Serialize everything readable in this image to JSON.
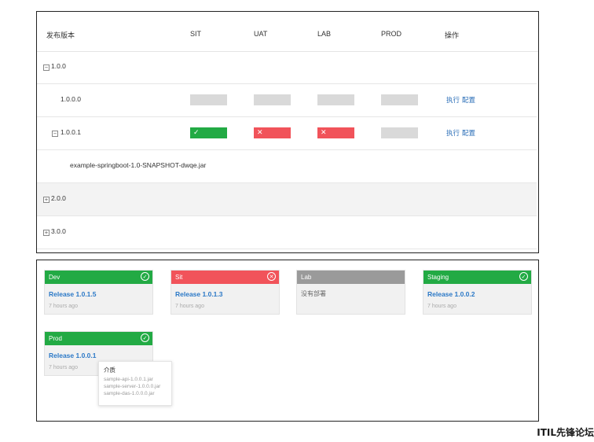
{
  "table": {
    "headers": {
      "version": "发布版本",
      "sit": "SIT",
      "uat": "UAT",
      "lab": "LAB",
      "prod": "PROD",
      "ops": "操作"
    },
    "rows": [
      {
        "toggle": "−",
        "label": "1.0.0"
      },
      {
        "label": "1.0.0.0",
        "sit": "empty",
        "uat": "empty",
        "lab": "empty",
        "prod": "empty",
        "execute": "执行",
        "config": "配置"
      },
      {
        "toggle": "−",
        "label": "1.0.0.1",
        "sit": "success",
        "uat": "failed",
        "lab": "failed",
        "prod": "empty",
        "sit_mark": "✓",
        "uat_mark": "✕",
        "lab_mark": "✕",
        "execute": "执行",
        "config": "配置"
      },
      {
        "label": "example-springboot-1.0-SNAPSHOT-dwqe.jar"
      },
      {
        "toggle": "+",
        "label": "2.0.0"
      },
      {
        "toggle": "+",
        "label": "3.0.0"
      }
    ]
  },
  "environments": [
    {
      "name": "Dev",
      "status_color": "#22aa44",
      "icon": "check-circle-icon",
      "icon_glyph": "✓",
      "release": "Release 1.0.1.5",
      "time": "7 hours ago"
    },
    {
      "name": "Sit",
      "status_color": "#f1535a",
      "icon": "close-circle-icon",
      "icon_glyph": "✕",
      "release": "Release 1.0.1.3",
      "time": "7 hours ago"
    },
    {
      "name": "Lab",
      "status_color": "#9a9a9a",
      "note": "没有部署"
    },
    {
      "name": "Staging",
      "status_color": "#22aa44",
      "icon": "check-circle-icon",
      "icon_glyph": "✓",
      "release": "Release 1.0.0.2",
      "time": "7 hours ago"
    },
    {
      "name": "Prod",
      "status_color": "#22aa44",
      "icon": "check-circle-icon",
      "icon_glyph": "✓",
      "release": "Release 1.0.0.1",
      "time": "7 hours ago"
    }
  ],
  "popup": {
    "title": "介质",
    "items": [
      "sample-api-1.0.0.1.jar",
      "sample-server-1.0.0.0.jar",
      "sample-das-1.0.0.0.jar"
    ]
  },
  "watermark": "ITIL先锋论坛"
}
